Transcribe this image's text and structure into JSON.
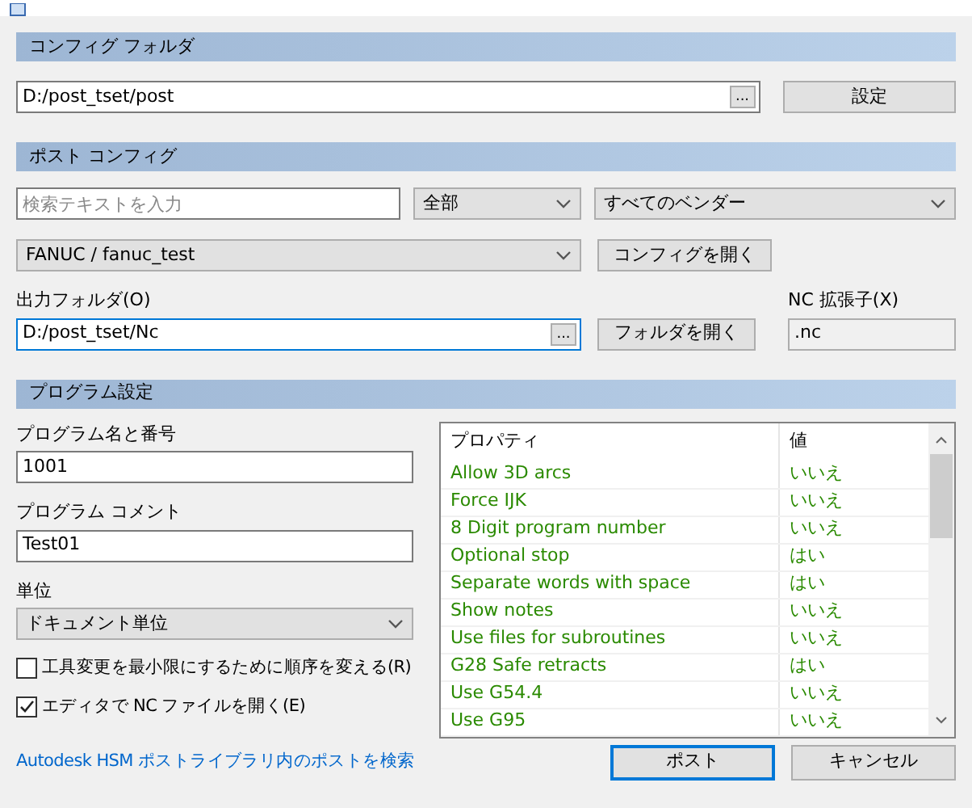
{
  "config_folder": {
    "header": "コンフィグ フォルダ",
    "path": "D:/post_tset/post",
    "browse_button": "...",
    "set_button": "設定"
  },
  "post_config": {
    "header": "ポスト コンフィグ",
    "search": {
      "placeholder": "検索テキストを入力"
    },
    "category": "全部",
    "vendor": "すべてのベンダー",
    "post": "FANUC / fanuc_test",
    "open_config_button": "コンフィグを開く",
    "output_folder": {
      "label": "出力フォルダ(O)",
      "value": "D:/post_tset/Nc",
      "browse_button": "..."
    },
    "open_folder_button": "フォルダを開く",
    "nc_extension": {
      "label": "NC 拡張子(X)",
      "value": ".nc"
    }
  },
  "program_settings": {
    "header": "プログラム設定",
    "program_name": {
      "label": "プログラム名と番号",
      "value": "1001"
    },
    "program_comment": {
      "label": "プログラム コメント",
      "value": "Test01"
    },
    "units": {
      "label": "単位",
      "value": "ドキュメント単位"
    },
    "checkboxes": [
      {
        "label": "工具変更を最小限にするために順序を変える(R)",
        "checked": false
      },
      {
        "label": "エディタで NC ファイルを開く(E)",
        "checked": true
      }
    ],
    "properties": {
      "columns": [
        "プロパティ",
        "値"
      ],
      "rows": [
        {
          "name": "Allow 3D arcs",
          "value": "いいえ"
        },
        {
          "name": "Force IJK",
          "value": "いいえ"
        },
        {
          "name": "8 Digit program number",
          "value": "いいえ"
        },
        {
          "name": "Optional stop",
          "value": "はい"
        },
        {
          "name": "Separate words with space",
          "value": "はい"
        },
        {
          "name": "Show notes",
          "value": "いいえ"
        },
        {
          "name": "Use files for subroutines",
          "value": "いいえ"
        },
        {
          "name": "G28 Safe retracts",
          "value": "はい"
        },
        {
          "name": "Use G54.4",
          "value": "いいえ"
        },
        {
          "name": "Use G95",
          "value": "いいえ"
        }
      ]
    }
  },
  "footer": {
    "link": "Autodesk HSM ポストライブラリ内のポストを検索",
    "buttons": [
      {
        "label": "ポスト",
        "selected": true
      },
      {
        "label": "キャンセル",
        "selected": false
      }
    ]
  }
}
